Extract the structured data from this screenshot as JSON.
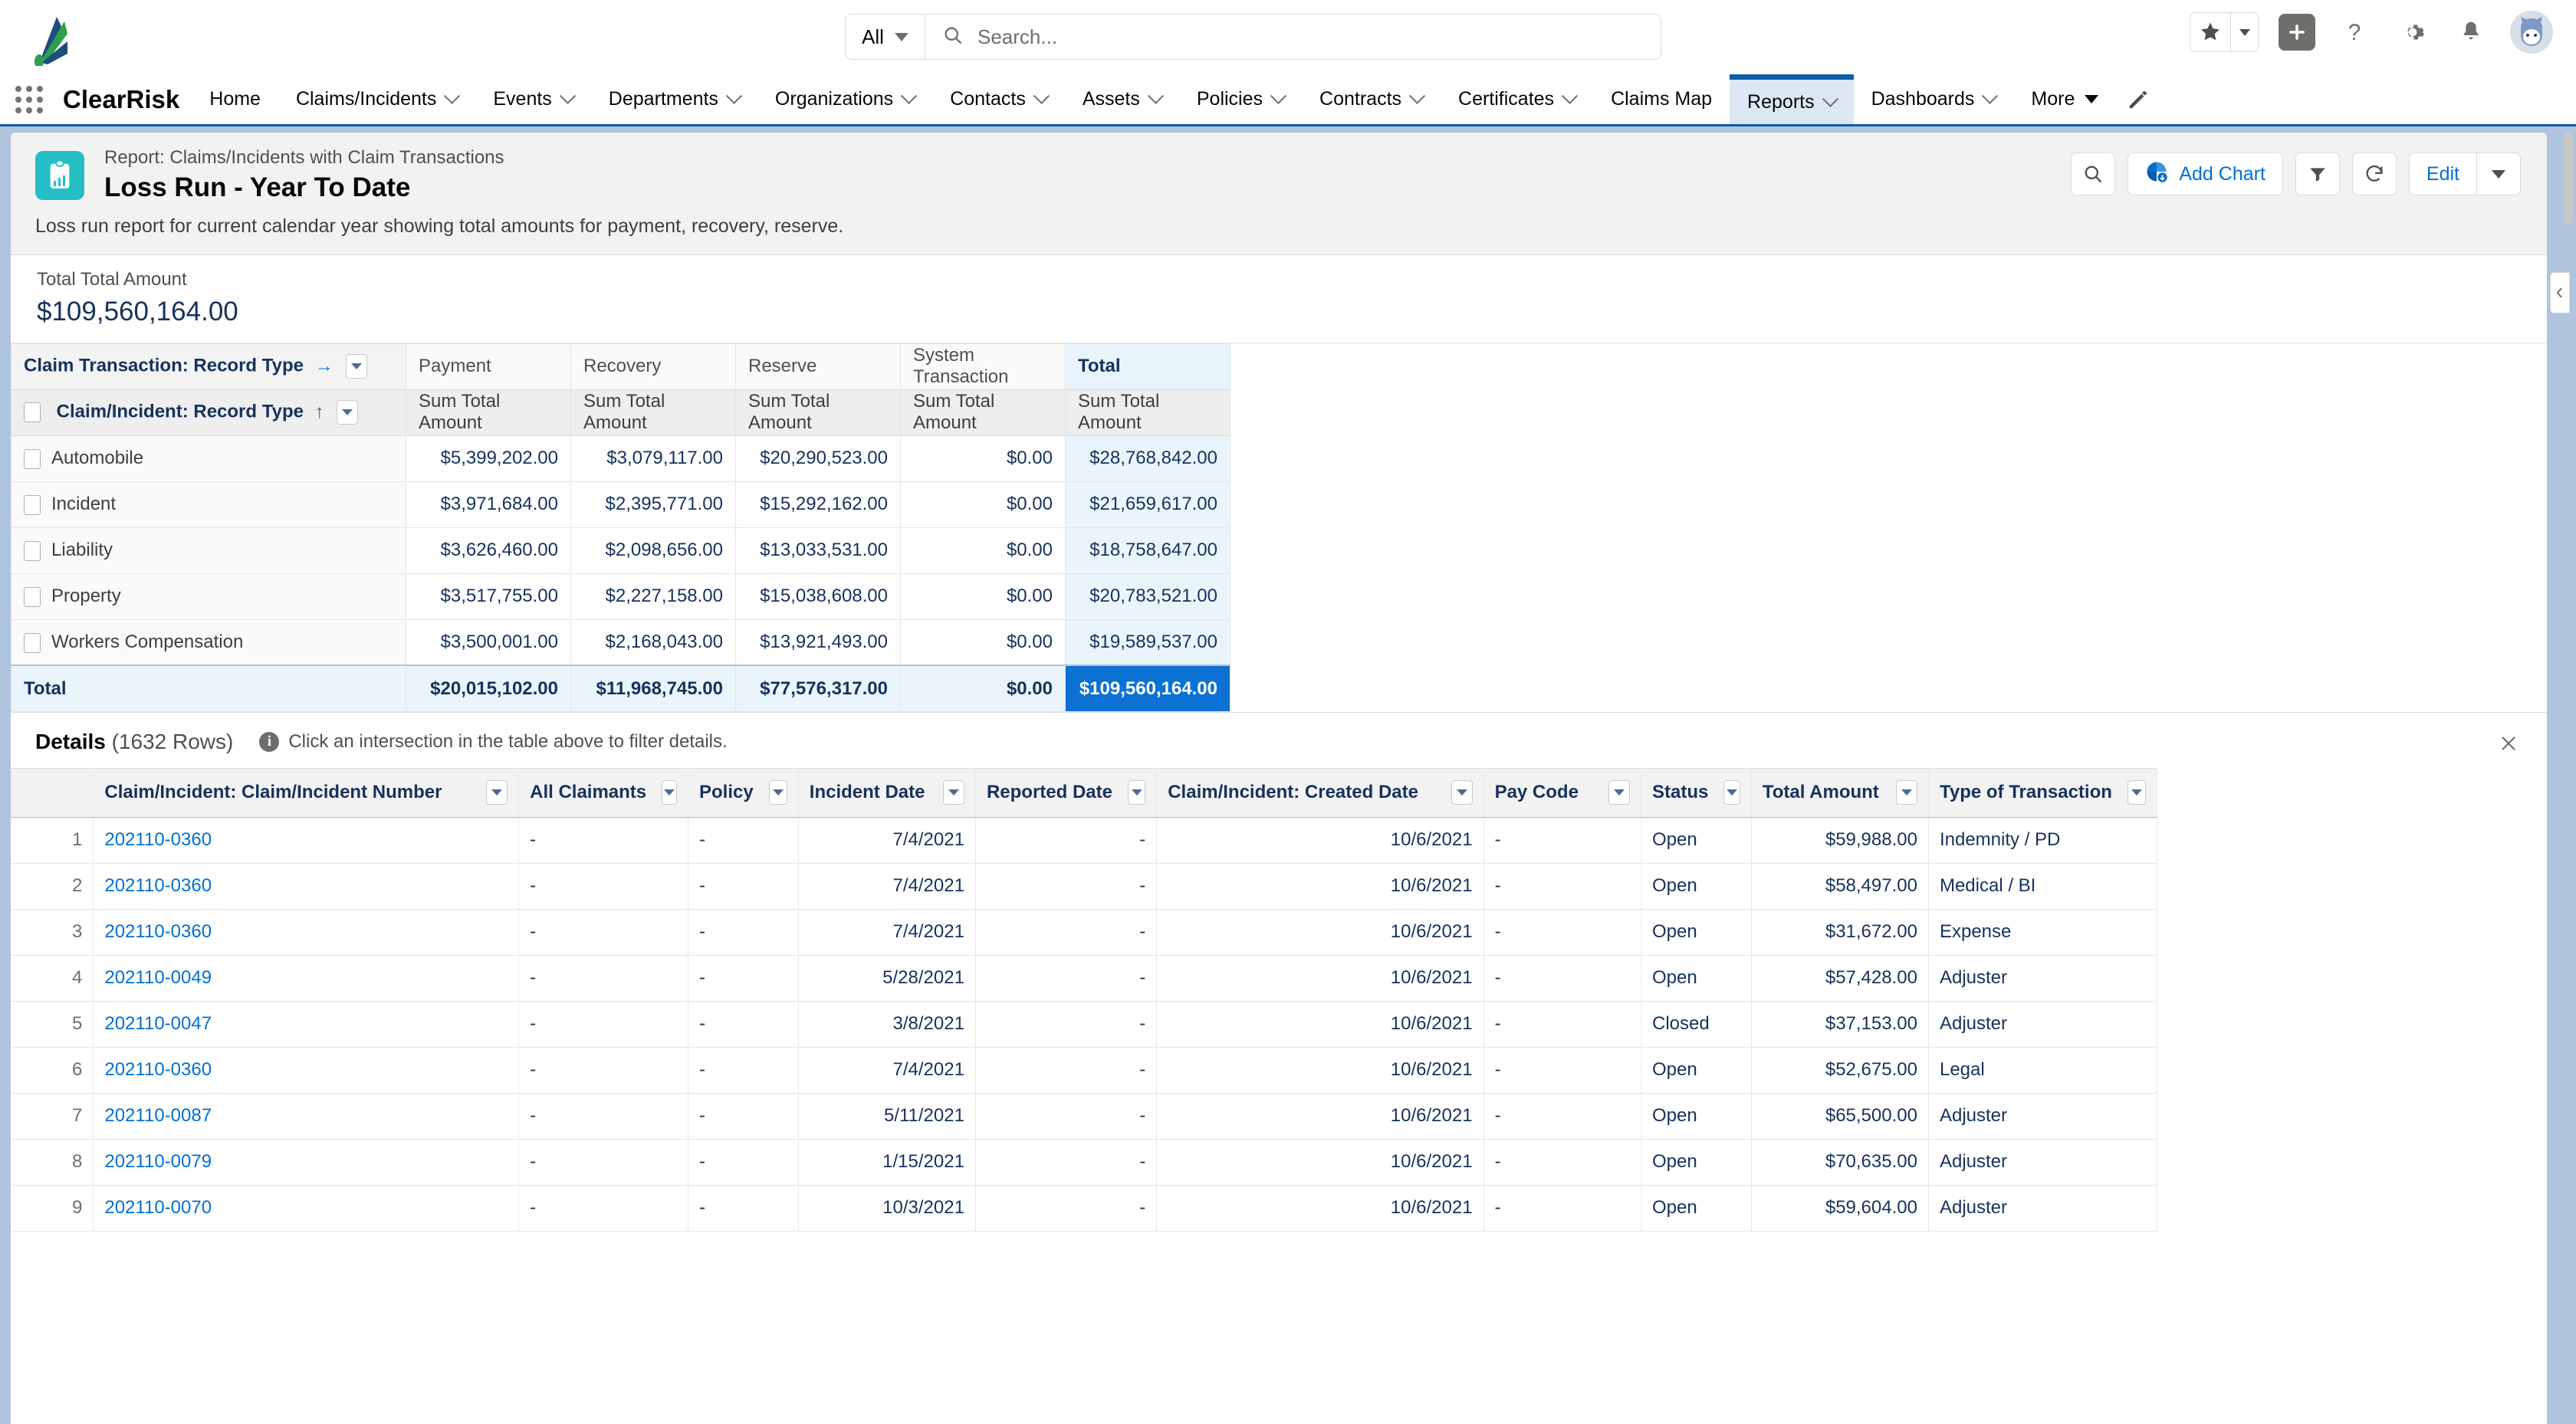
{
  "global": {
    "search": {
      "scope": "All",
      "placeholder": "Search...",
      "value": ""
    },
    "icons": {
      "search": "search-icon",
      "favorites": "star-icon",
      "plus": "plus-icon",
      "help": "question-mark-icon",
      "setup": "gear-icon",
      "notifications": "bell-icon",
      "avatar": "user-avatar"
    }
  },
  "nav": {
    "app_name": "ClearRisk",
    "items": [
      {
        "label": "Home",
        "has_menu": false,
        "active": false
      },
      {
        "label": "Claims/Incidents",
        "has_menu": true,
        "active": false
      },
      {
        "label": "Events",
        "has_menu": true,
        "active": false
      },
      {
        "label": "Departments",
        "has_menu": true,
        "active": false
      },
      {
        "label": "Organizations",
        "has_menu": true,
        "active": false
      },
      {
        "label": "Contacts",
        "has_menu": true,
        "active": false
      },
      {
        "label": "Assets",
        "has_menu": true,
        "active": false
      },
      {
        "label": "Policies",
        "has_menu": true,
        "active": false
      },
      {
        "label": "Contracts",
        "has_menu": true,
        "active": false
      },
      {
        "label": "Certificates",
        "has_menu": true,
        "active": false
      },
      {
        "label": "Claims Map",
        "has_menu": false,
        "active": false
      },
      {
        "label": "Reports",
        "has_menu": true,
        "active": true
      },
      {
        "label": "Dashboards",
        "has_menu": true,
        "active": false
      },
      {
        "label": "More",
        "has_menu": true,
        "active": false
      }
    ]
  },
  "report": {
    "eyebrow": "Report: Claims/Incidents with Claim Transactions",
    "title": "Loss Run - Year To Date",
    "description": "Loss run report for current calendar year showing total amounts for payment, recovery, reserve.",
    "actions": {
      "search": "search-icon",
      "add_chart": "Add Chart",
      "filter": "filter-icon",
      "refresh": "refresh-icon",
      "edit": "Edit",
      "more": "chevron-down-icon"
    },
    "summary": {
      "label": "Total Total Amount",
      "value": "$109,560,164.00"
    }
  },
  "chart_data": {
    "type": "table",
    "title": "Loss Run - Year To Date",
    "row_group_header": "Claim/Incident: Record Type",
    "column_group_header": "Claim Transaction: Record Type",
    "measure_label": "Sum Total Amount",
    "categories": [
      "Payment",
      "Recovery",
      "Reserve",
      "System Transaction",
      "Total"
    ],
    "rows": [
      {
        "label": "Automobile",
        "values": [
          "$5,399,202.00",
          "$3,079,117.00",
          "$20,290,523.00",
          "$0.00",
          "$28,768,842.00"
        ],
        "numeric": [
          5399202,
          3079117,
          20290523,
          0,
          28768842
        ]
      },
      {
        "label": "Incident",
        "values": [
          "$3,971,684.00",
          "$2,395,771.00",
          "$15,292,162.00",
          "$0.00",
          "$21,659,617.00"
        ],
        "numeric": [
          3971684,
          2395771,
          15292162,
          0,
          21659617
        ]
      },
      {
        "label": "Liability",
        "values": [
          "$3,626,460.00",
          "$2,098,656.00",
          "$13,033,531.00",
          "$0.00",
          "$18,758,647.00"
        ],
        "numeric": [
          3626460,
          2098656,
          13033531,
          0,
          18758647
        ]
      },
      {
        "label": "Property",
        "values": [
          "$3,517,755.00",
          "$2,227,158.00",
          "$15,038,608.00",
          "$0.00",
          "$20,783,521.00"
        ],
        "numeric": [
          3517755,
          2227158,
          15038608,
          0,
          20783521
        ]
      },
      {
        "label": "Workers Compensation",
        "values": [
          "$3,500,001.00",
          "$2,168,043.00",
          "$13,921,493.00",
          "$0.00",
          "$19,589,537.00"
        ],
        "numeric": [
          3500001,
          2168043,
          13921493,
          0,
          19589537
        ]
      }
    ],
    "total_row": {
      "label": "Total",
      "values": [
        "$20,015,102.00",
        "$11,968,745.00",
        "$77,576,317.00",
        "$0.00",
        "$109,560,164.00"
      ],
      "numeric": [
        20015102,
        11968745,
        77576317,
        0,
        109560164
      ]
    }
  },
  "details": {
    "title": "Details",
    "count": "(1632 Rows)",
    "hint": "Click an intersection in the table above to filter details.",
    "columns": [
      "Claim/Incident: Claim/Incident Number",
      "All Claimants",
      "Policy",
      "Incident Date",
      "Reported Date",
      "Claim/Incident: Created Date",
      "Pay Code",
      "Status",
      "Total Amount",
      "Type of Transaction"
    ],
    "rows": [
      {
        "idx": "1",
        "number": "202110-0360",
        "claimants": "-",
        "policy": "-",
        "incident_date": "7/4/2021",
        "reported_date": "-",
        "created_date": "10/6/2021",
        "pay_code": "-",
        "status": "Open",
        "total_amount": "$59,988.00",
        "type": "Indemnity / PD"
      },
      {
        "idx": "2",
        "number": "202110-0360",
        "claimants": "-",
        "policy": "-",
        "incident_date": "7/4/2021",
        "reported_date": "-",
        "created_date": "10/6/2021",
        "pay_code": "-",
        "status": "Open",
        "total_amount": "$58,497.00",
        "type": "Medical / BI"
      },
      {
        "idx": "3",
        "number": "202110-0360",
        "claimants": "-",
        "policy": "-",
        "incident_date": "7/4/2021",
        "reported_date": "-",
        "created_date": "10/6/2021",
        "pay_code": "-",
        "status": "Open",
        "total_amount": "$31,672.00",
        "type": "Expense"
      },
      {
        "idx": "4",
        "number": "202110-0049",
        "claimants": "-",
        "policy": "-",
        "incident_date": "5/28/2021",
        "reported_date": "-",
        "created_date": "10/6/2021",
        "pay_code": "-",
        "status": "Open",
        "total_amount": "$57,428.00",
        "type": "Adjuster"
      },
      {
        "idx": "5",
        "number": "202110-0047",
        "claimants": "-",
        "policy": "-",
        "incident_date": "3/8/2021",
        "reported_date": "-",
        "created_date": "10/6/2021",
        "pay_code": "-",
        "status": "Closed",
        "total_amount": "$37,153.00",
        "type": "Adjuster"
      },
      {
        "idx": "6",
        "number": "202110-0360",
        "claimants": "-",
        "policy": "-",
        "incident_date": "7/4/2021",
        "reported_date": "-",
        "created_date": "10/6/2021",
        "pay_code": "-",
        "status": "Open",
        "total_amount": "$52,675.00",
        "type": "Legal"
      },
      {
        "idx": "7",
        "number": "202110-0087",
        "claimants": "-",
        "policy": "-",
        "incident_date": "5/11/2021",
        "reported_date": "-",
        "created_date": "10/6/2021",
        "pay_code": "-",
        "status": "Open",
        "total_amount": "$65,500.00",
        "type": "Adjuster"
      },
      {
        "idx": "8",
        "number": "202110-0079",
        "claimants": "-",
        "policy": "-",
        "incident_date": "1/15/2021",
        "reported_date": "-",
        "created_date": "10/6/2021",
        "pay_code": "-",
        "status": "Open",
        "total_amount": "$70,635.00",
        "type": "Adjuster"
      },
      {
        "idx": "9",
        "number": "202110-0070",
        "claimants": "-",
        "policy": "-",
        "incident_date": "10/3/2021",
        "reported_date": "-",
        "created_date": "10/6/2021",
        "pay_code": "-",
        "status": "Open",
        "total_amount": "$59,604.00",
        "type": "Adjuster"
      }
    ]
  },
  "colors": {
    "brand_blue": "#0b5cab",
    "link_blue": "#0070d2",
    "report_icon_teal": "#24bfc4",
    "grand_total_blue": "#0b72d4",
    "page_bg": "#b0c4de"
  }
}
